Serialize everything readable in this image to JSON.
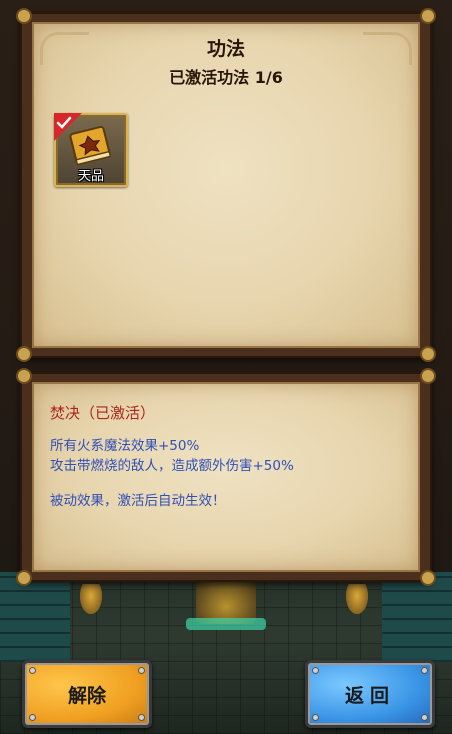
{
  "panel": {
    "title": "功法",
    "subtitle": "已激活功法 1/6"
  },
  "skill_slots": [
    {
      "icon": "golden-book-icon",
      "label": "天品",
      "activated": true
    }
  ],
  "description": {
    "title": "焚决（已激活）",
    "lines": [
      "所有火系魔法效果+50%",
      "攻击带燃烧的敌人，造成额外伤害+50%",
      "被动效果，激活后自动生效！"
    ]
  },
  "buttons": {
    "unequip_label": "解除",
    "return_label": "返回"
  },
  "colors": {
    "desc_title": "#a8261a",
    "desc_text": "#3050b8",
    "unequip_button": "#f0a022",
    "return_button": "#3a95e6"
  }
}
